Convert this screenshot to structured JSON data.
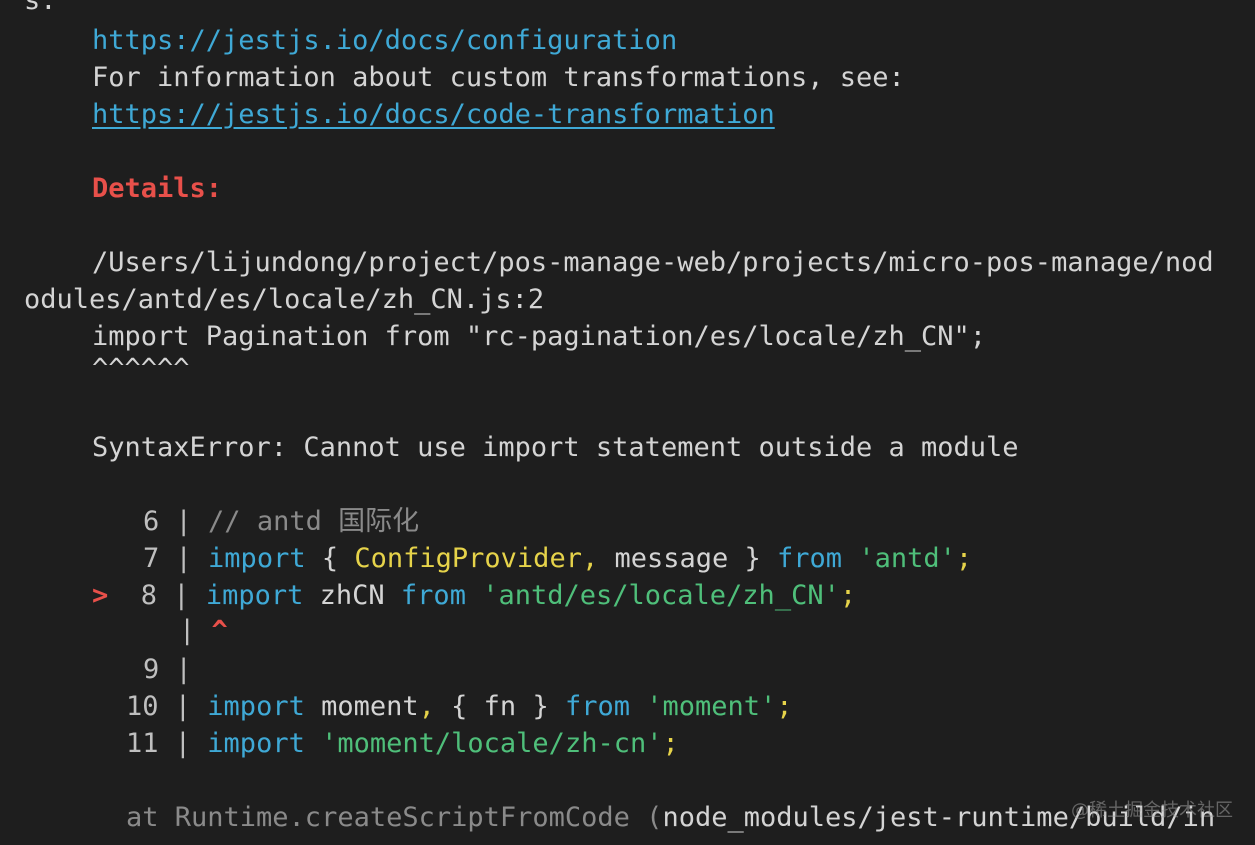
{
  "lines": {
    "l0": "s:",
    "l1_url": "https://jestjs.io/docs/configuration",
    "l2": "For information about custom transformations, see:",
    "l3_url": "https://jestjs.io/docs/code-transformation",
    "l5_details": "Details:",
    "l7_path": "/Users/lijundong/project/pos-manage-web/projects/micro-pos-manage/nod",
    "l8_path": "odules/antd/es/locale/zh_CN.js:2",
    "l9": "import Pagination from \"rc-pagination/es/locale/zh_CN\";",
    "l10_carets": "^^^^^^",
    "l12_error": "SyntaxError: Cannot use import statement outside a module"
  },
  "code": {
    "r6": {
      "num": "6",
      "sep": " | ",
      "comment": "// antd 国际化"
    },
    "r7": {
      "num": "7",
      "sep": " | ",
      "kw1": "import",
      "t1": " { ",
      "id1": "ConfigProvider",
      "p1": ",",
      "t2": " message } ",
      "kw2": "from",
      "t3": " ",
      "str": "'antd'",
      "p2": ";"
    },
    "r8": {
      "marker": ">",
      "num": "8",
      "sep": " | ",
      "kw1": "import",
      "t1": " zhCN ",
      "kw2": "from",
      "t2": " ",
      "str": "'antd/es/locale/zh_CN'",
      "p2": ";"
    },
    "r8b": {
      "sep": "|",
      "caret": "^"
    },
    "r9": {
      "num": "9",
      "sep": " |"
    },
    "r10": {
      "num": "10",
      "sep": " | ",
      "kw1": "import",
      "t1": " moment",
      "p1": ",",
      "t2": " { fn } ",
      "kw2": "from",
      "t3": " ",
      "str": "'moment'",
      "p2": ";"
    },
    "r11": {
      "num": "11",
      "sep": " | ",
      "kw1": "import",
      "t1": " ",
      "str": "'moment/locale/zh-cn'",
      "p2": ";"
    }
  },
  "stack": {
    "at": "at Runtime.createScriptFromCode (",
    "loc": "node_modules/jest-runtime/build/in"
  },
  "watermark": "@稀土掘金技术社区"
}
